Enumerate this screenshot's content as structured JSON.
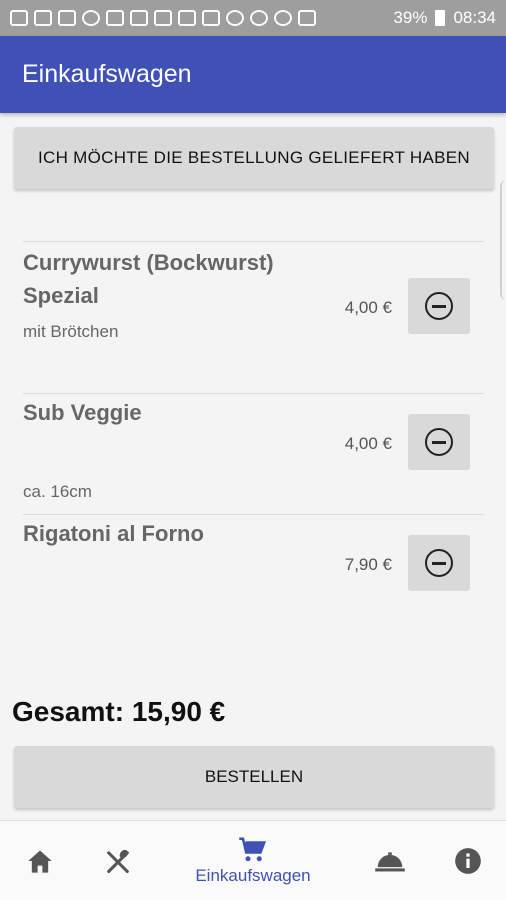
{
  "status_bar": {
    "battery": "39%",
    "time": "08:34"
  },
  "appbar": {
    "title": "Einkaufswagen"
  },
  "delivery_button": "ICH MÖCHTE DIE BESTELLUNG GELIEFERT HABEN",
  "items": [
    {
      "name": "Currywurst (Bockwurst) Spezial",
      "price": "4,00 €",
      "description": "mit Brötchen"
    },
    {
      "name": "Sub Veggie",
      "price": "4,00 €",
      "description": "ca. 16cm"
    },
    {
      "name": "Rigatoni al Forno",
      "price": "7,90 €",
      "description": ""
    }
  ],
  "total": "Gesamt: 15,90 €",
  "order_button": "BESTELLEN",
  "bottom_nav": {
    "cart_label": "Einkaufswagen",
    "icons": [
      "home-icon",
      "cutlery-icon",
      "cart-icon",
      "cloche-icon",
      "info-icon"
    ],
    "active_color": "#3f51b5"
  },
  "colors": {
    "primary": "#3f51b5",
    "button_bg": "#d9d9d9"
  }
}
